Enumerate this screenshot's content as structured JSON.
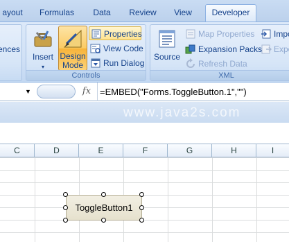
{
  "tabs": [
    {
      "label": "ayout"
    },
    {
      "label": "Formulas"
    },
    {
      "label": "Data"
    },
    {
      "label": "Review"
    },
    {
      "label": "View"
    },
    {
      "label": "Developer"
    }
  ],
  "ribbon": {
    "left_partial_label": "ences",
    "controls": {
      "group_label": "Controls",
      "insert_label": "Insert",
      "design_mode_line1": "Design",
      "design_mode_line2": "Mode",
      "properties_label": "Properties",
      "view_code_label": "View Code",
      "run_dialog_label": "Run Dialog"
    },
    "xml": {
      "group_label": "XML",
      "source_label": "Source",
      "map_properties_label": "Map Properties",
      "expansion_packs_label": "Expansion Packs",
      "refresh_data_label": "Refresh Data",
      "import_partial": "Impo",
      "export_partial": "Expo"
    }
  },
  "formula_bar": {
    "fx_label": "fx",
    "formula": "=EMBED(\"Forms.ToggleButton.1\",\"\")"
  },
  "watermark": "www.java2s.com",
  "sheet": {
    "columns": [
      "C",
      "D",
      "E",
      "F",
      "G",
      "H",
      "I"
    ],
    "toggle_button_label": "ToggleButton1"
  },
  "colors": {
    "accent": "#15428b",
    "pressed_button": "#fbcb64",
    "ribbon_bg": "#d1e1f6"
  }
}
